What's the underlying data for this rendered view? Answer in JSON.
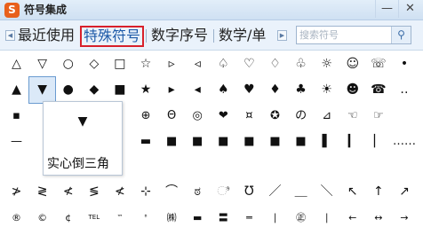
{
  "window": {
    "title": "符号集成",
    "logo_text": "S",
    "min_label": "—",
    "close_label": "✕"
  },
  "tabs": [
    {
      "label": "最近使用"
    },
    {
      "label": "特殊符号",
      "selected": true
    },
    {
      "label": "数字序号"
    },
    {
      "label": "数学/单"
    }
  ],
  "search": {
    "placeholder": "搜索符号",
    "icon": "search-icon"
  },
  "colors": {
    "accent": "#1e5aa8",
    "selected_border": "#d8202a",
    "tab_bg": "#eaf2fb"
  },
  "rows": [
    [
      "△",
      "▽",
      "○",
      "◇",
      "□",
      "☆",
      "▹",
      "◃",
      "♤",
      "♡",
      "♢",
      "♧",
      "☼",
      "☺",
      "☏",
      "•"
    ],
    [
      "▲",
      "▼",
      "●",
      "◆",
      "■",
      "★",
      "▸",
      "◂",
      "♠",
      "♥",
      "♦",
      "♣",
      "☀",
      "☻",
      "☎",
      "‥"
    ],
    [
      "▪",
      "",
      "",
      "",
      "",
      "⊕",
      "Θ",
      "◎",
      "❤",
      "¤",
      "✪",
      "の",
      "⊿",
      "☜",
      "☞",
      ""
    ],
    [
      "—",
      "",
      "",
      "",
      "",
      "▬",
      "■",
      "■",
      "■",
      "■",
      "■",
      "■",
      "▌",
      "▎",
      "▏",
      "……"
    ],
    [
      "≯",
      "≷",
      "≮",
      "≶",
      "≮",
      "⊹",
      "⌒",
      "ಠ",
      "ಿ",
      "Ʊ",
      "／",
      "＿",
      "＼",
      "↖",
      "↑",
      "↗"
    ],
    [
      "®",
      "©",
      "¢",
      "TEL",
      "™",
      "ᴮ",
      "㈱",
      "▬",
      "〓",
      "═",
      "∣",
      "㊣",
      "∣",
      "←",
      "↔",
      "→"
    ]
  ],
  "tooltip": {
    "glyph": "▼",
    "label": "实心倒三角"
  }
}
